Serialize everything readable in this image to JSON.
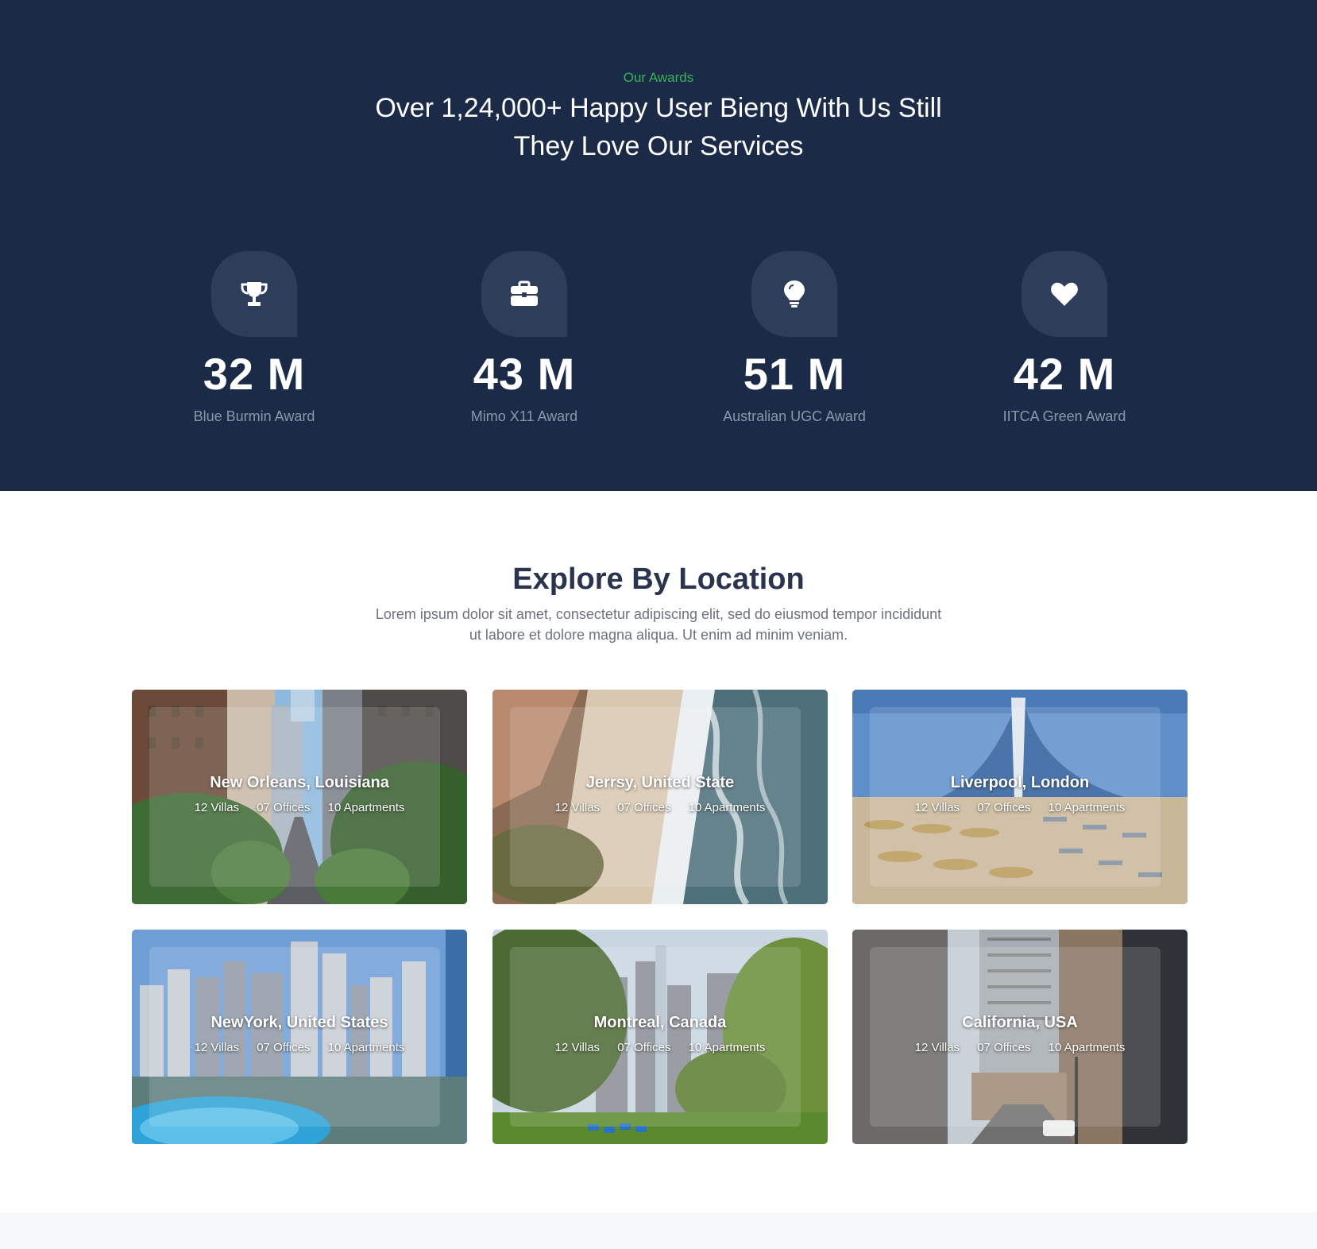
{
  "awards": {
    "eyebrow": "Our Awards",
    "title_line1": "Over 1,24,000+ Happy User Bieng With Us Still",
    "title_line2": "They Love Our Services",
    "items": [
      {
        "icon": "trophy-icon",
        "value": "32 M",
        "label": "Blue Burmin Award"
      },
      {
        "icon": "briefcase-icon",
        "value": "43 M",
        "label": "Mimo X11 Award"
      },
      {
        "icon": "lightbulb-icon",
        "value": "51 M",
        "label": "Australian UGC Award"
      },
      {
        "icon": "heart-icon",
        "value": "42 M",
        "label": "IITCA Green Award"
      }
    ]
  },
  "explore": {
    "title": "Explore By Location",
    "desc_line1": "Lorem ipsum dolor sit amet, consectetur adipiscing elit, sed do eiusmod tempor incididunt",
    "desc_line2": "ut labore et dolore magna aliqua. Ut enim ad minim veniam.",
    "locations": [
      {
        "name": "New Orleans, Louisiana",
        "villas": "12 Villas",
        "offices": "07 Offices",
        "apartments": "10 Apartments"
      },
      {
        "name": "Jerrsy, United State",
        "villas": "12 Villas",
        "offices": "07 Offices",
        "apartments": "10 Apartments"
      },
      {
        "name": "Liverpool, London",
        "villas": "12 Villas",
        "offices": "07 Offices",
        "apartments": "10 Apartments"
      },
      {
        "name": "NewYork, United States",
        "villas": "12 Villas",
        "offices": "07 Offices",
        "apartments": "10 Apartments"
      },
      {
        "name": "Montreal, Canada",
        "villas": "12 Villas",
        "offices": "07 Offices",
        "apartments": "10 Apartments"
      },
      {
        "name": "California, USA",
        "villas": "12 Villas",
        "offices": "07 Offices",
        "apartments": "10 Apartments"
      }
    ]
  },
  "colors": {
    "awards_bg": "#1b2a47",
    "accent_green": "#35b35b",
    "icon_tile": "#2d3d5a",
    "heading_dark": "#2a344f"
  }
}
